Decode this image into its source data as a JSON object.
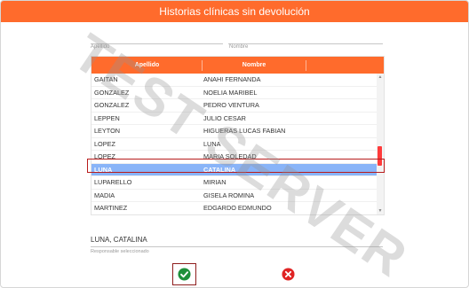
{
  "dialog": {
    "title": "Historias clínicas sin devolución"
  },
  "filters": {
    "apellido": {
      "label": "Apellido",
      "value": ""
    },
    "nombre": {
      "label": "Nombre",
      "value": ""
    }
  },
  "table": {
    "headers": [
      "Apellido",
      "Nombre"
    ],
    "rows": [
      {
        "apellido": "GAITAN",
        "nombre": "ANAHI FERNANDA"
      },
      {
        "apellido": "GONZALEZ",
        "nombre": "NOELIA MARIBEL"
      },
      {
        "apellido": "GONZALEZ",
        "nombre": "PEDRO VENTURA"
      },
      {
        "apellido": "LEPPEN",
        "nombre": "JULIO CESAR"
      },
      {
        "apellido": "LEYTON",
        "nombre": "HIGUERAS LUCAS FABIAN"
      },
      {
        "apellido": "LOPEZ",
        "nombre": "LUNA"
      },
      {
        "apellido": "LOPEZ",
        "nombre": "MARIA SOLEDAD"
      },
      {
        "apellido": "LUNA",
        "nombre": "CATALINA",
        "selected": true
      },
      {
        "apellido": "LUPARELLO",
        "nombre": "MIRIAN"
      },
      {
        "apellido": "MADIA",
        "nombre": "GISELA ROMINA"
      },
      {
        "apellido": "MARTINEZ",
        "nombre": "EDGARDO EDMUNDO"
      }
    ]
  },
  "selection": {
    "value": "LUNA, CATALINA",
    "label": "Responsable seleccionado"
  },
  "buttons": {
    "confirm_icon": "check-circle-icon",
    "cancel_icon": "x-circle-icon"
  },
  "watermark": "TEST SERVER",
  "colors": {
    "accent": "#ff6b2c",
    "selected_row": "#89b4f8",
    "confirm": "#1f8f3a",
    "cancel": "#e02424"
  }
}
